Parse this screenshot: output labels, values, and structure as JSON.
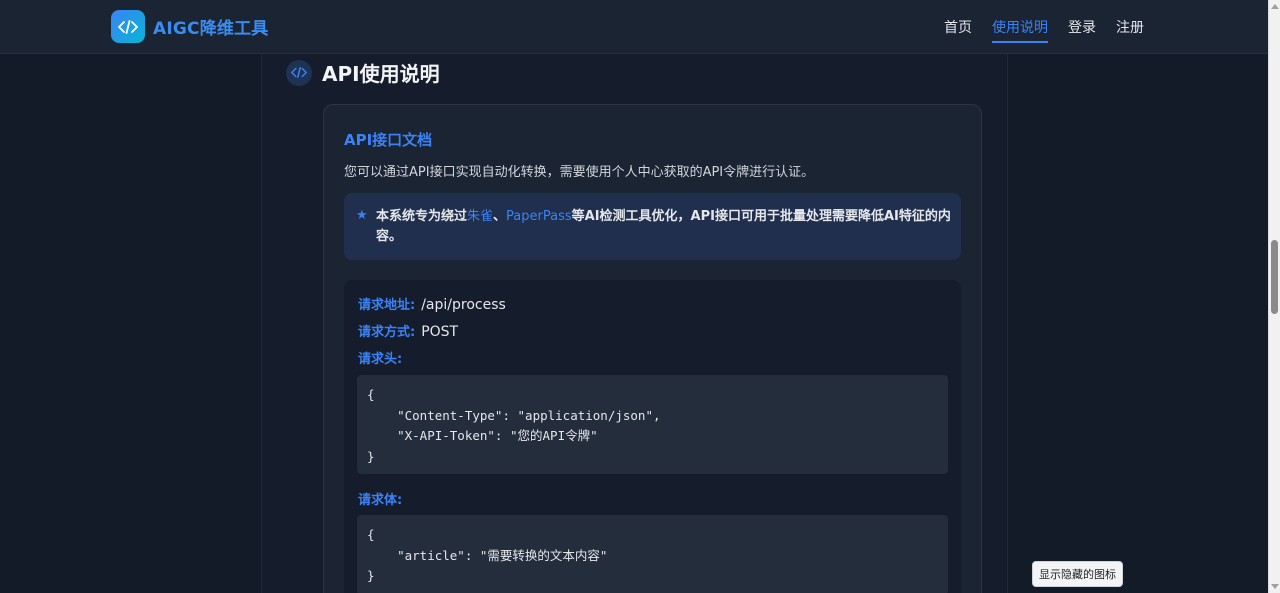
{
  "brand": {
    "name": "AIGC降维工具",
    "logo_icon": "code-icon"
  },
  "nav": {
    "items": [
      {
        "label": "首页",
        "active": false
      },
      {
        "label": "使用说明",
        "active": true
      },
      {
        "label": "登录",
        "active": false
      },
      {
        "label": "注册",
        "active": false
      }
    ]
  },
  "section": {
    "title": "API使用说明",
    "icon": "code-icon"
  },
  "card": {
    "title": "API接口文档",
    "intro": "您可以通过API接口实现自动化转换，需要使用个人中心获取的API令牌进行认证。",
    "notice": {
      "icon": "star-icon",
      "prefix": "本系统专为绕过",
      "highlight1": "朱雀",
      "sep": "、",
      "highlight2": "PaperPass",
      "suffix": "等AI检测工具优化，API接口可用于批量处理需要降低AI特征的内容。"
    },
    "request": {
      "url_label": "请求地址:",
      "url_value": "/api/process",
      "method_label": "请求方式:",
      "method_value": "POST",
      "headers_label": "请求头:",
      "headers_code": "{\n    \"Content-Type\": \"application/json\",\n    \"X-API-Token\": \"您的API令牌\"\n}",
      "body_label": "请求体:",
      "body_code": "{\n    \"article\": \"需要转换的文本内容\"\n}"
    }
  },
  "floating_button": {
    "label": "显示隐藏的图标"
  },
  "colors": {
    "accent": "#3b82f6",
    "background": "#131a28",
    "card": "#1b2433"
  }
}
